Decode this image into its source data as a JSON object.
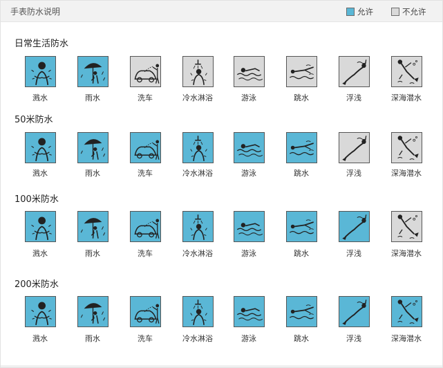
{
  "header": {
    "title": "手表防水说明",
    "legend": {
      "allowed": {
        "label": "允许",
        "color": "#5ab7d6"
      },
      "not_allowed": {
        "label": "不允许",
        "color": "#d9d9d9"
      }
    }
  },
  "activities": [
    {
      "label": "溅水",
      "icon": "splash-person-icon"
    },
    {
      "label": "雨水",
      "icon": "umbrella-rain-icon"
    },
    {
      "label": "洗车",
      "icon": "car-wash-icon"
    },
    {
      "label": "冷水淋浴",
      "icon": "shower-icon"
    },
    {
      "label": "游泳",
      "icon": "swimming-icon"
    },
    {
      "label": "跳水",
      "icon": "diving-icon"
    },
    {
      "label": "浮浅",
      "icon": "snorkeling-icon"
    },
    {
      "label": "深海潜水",
      "icon": "deep-sea-diving-icon"
    }
  ],
  "sections": [
    {
      "title": "日常生活防水",
      "allowed": [
        true,
        true,
        false,
        false,
        false,
        false,
        false,
        false
      ]
    },
    {
      "title": "50米防水",
      "allowed": [
        true,
        true,
        true,
        true,
        true,
        true,
        false,
        false
      ]
    },
    {
      "title": "100米防水",
      "allowed": [
        true,
        true,
        true,
        true,
        true,
        true,
        true,
        false
      ]
    },
    {
      "title": "200米防水",
      "allowed": [
        true,
        true,
        true,
        true,
        true,
        true,
        true,
        true
      ]
    }
  ]
}
